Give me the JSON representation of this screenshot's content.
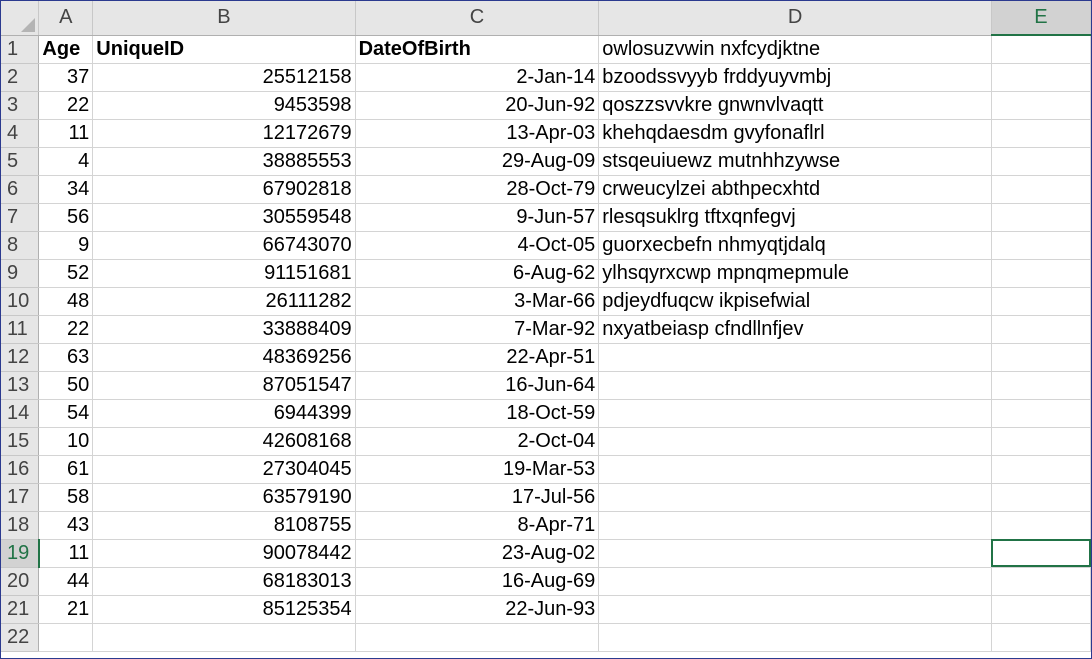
{
  "columns": [
    "A",
    "B",
    "C",
    "D",
    "E"
  ],
  "row_numbers": [
    "1",
    "2",
    "3",
    "4",
    "5",
    "6",
    "7",
    "8",
    "9",
    "10",
    "11",
    "12",
    "13",
    "14",
    "15",
    "16",
    "17",
    "18",
    "19",
    "20",
    "21",
    "22"
  ],
  "selection": {
    "row": "19",
    "column": "E"
  },
  "header_row": {
    "age": "Age",
    "unique_id": "UniqueID",
    "dob": "DateOfBirth",
    "d": "owlosuzvwin nxfcydjktne"
  },
  "rows": [
    {
      "age": "37",
      "id": "25512158",
      "dob": "2-Jan-14",
      "d": "bzoodssvyyb frddyuyvmbj"
    },
    {
      "age": "22",
      "id": "9453598",
      "dob": "20-Jun-92",
      "d": "qoszzsvvkre gnwnvlvaqtt"
    },
    {
      "age": "11",
      "id": "12172679",
      "dob": "13-Apr-03",
      "d": "khehqdaesdm gvyfonaflrl"
    },
    {
      "age": "4",
      "id": "38885553",
      "dob": "29-Aug-09",
      "d": "stsqeuiuewz mutnhhzywse"
    },
    {
      "age": "34",
      "id": "67902818",
      "dob": "28-Oct-79",
      "d": "crweucylzei abthpecxhtd"
    },
    {
      "age": "56",
      "id": "30559548",
      "dob": "9-Jun-57",
      "d": "rlesqsuklrg tftxqnfegvj"
    },
    {
      "age": "9",
      "id": "66743070",
      "dob": "4-Oct-05",
      "d": "guorxecbefn nhmyqtjdalq"
    },
    {
      "age": "52",
      "id": "91151681",
      "dob": "6-Aug-62",
      "d": "ylhsqyrxcwp mpnqmepmule"
    },
    {
      "age": "48",
      "id": "26111282",
      "dob": "3-Mar-66",
      "d": "pdjeydfuqcw ikpisefwial"
    },
    {
      "age": "22",
      "id": "33888409",
      "dob": "7-Mar-92",
      "d": "nxyatbeiasp cfndllnfjev"
    },
    {
      "age": "63",
      "id": "48369256",
      "dob": "22-Apr-51",
      "d": ""
    },
    {
      "age": "50",
      "id": "87051547",
      "dob": "16-Jun-64",
      "d": ""
    },
    {
      "age": "54",
      "id": "6944399",
      "dob": "18-Oct-59",
      "d": ""
    },
    {
      "age": "10",
      "id": "42608168",
      "dob": "2-Oct-04",
      "d": ""
    },
    {
      "age": "61",
      "id": "27304045",
      "dob": "19-Mar-53",
      "d": ""
    },
    {
      "age": "58",
      "id": "63579190",
      "dob": "17-Jul-56",
      "d": ""
    },
    {
      "age": "43",
      "id": "8108755",
      "dob": "8-Apr-71",
      "d": ""
    },
    {
      "age": "11",
      "id": "90078442",
      "dob": "23-Aug-02",
      "d": ""
    },
    {
      "age": "44",
      "id": "68183013",
      "dob": "16-Aug-69",
      "d": ""
    },
    {
      "age": "21",
      "id": "85125354",
      "dob": "22-Jun-93",
      "d": ""
    },
    {
      "age": "",
      "id": "",
      "dob": "",
      "d": ""
    }
  ],
  "colors": {
    "accent": "#217346",
    "header_bg": "#e6e6e6",
    "gridline": "#d4d4d4"
  }
}
